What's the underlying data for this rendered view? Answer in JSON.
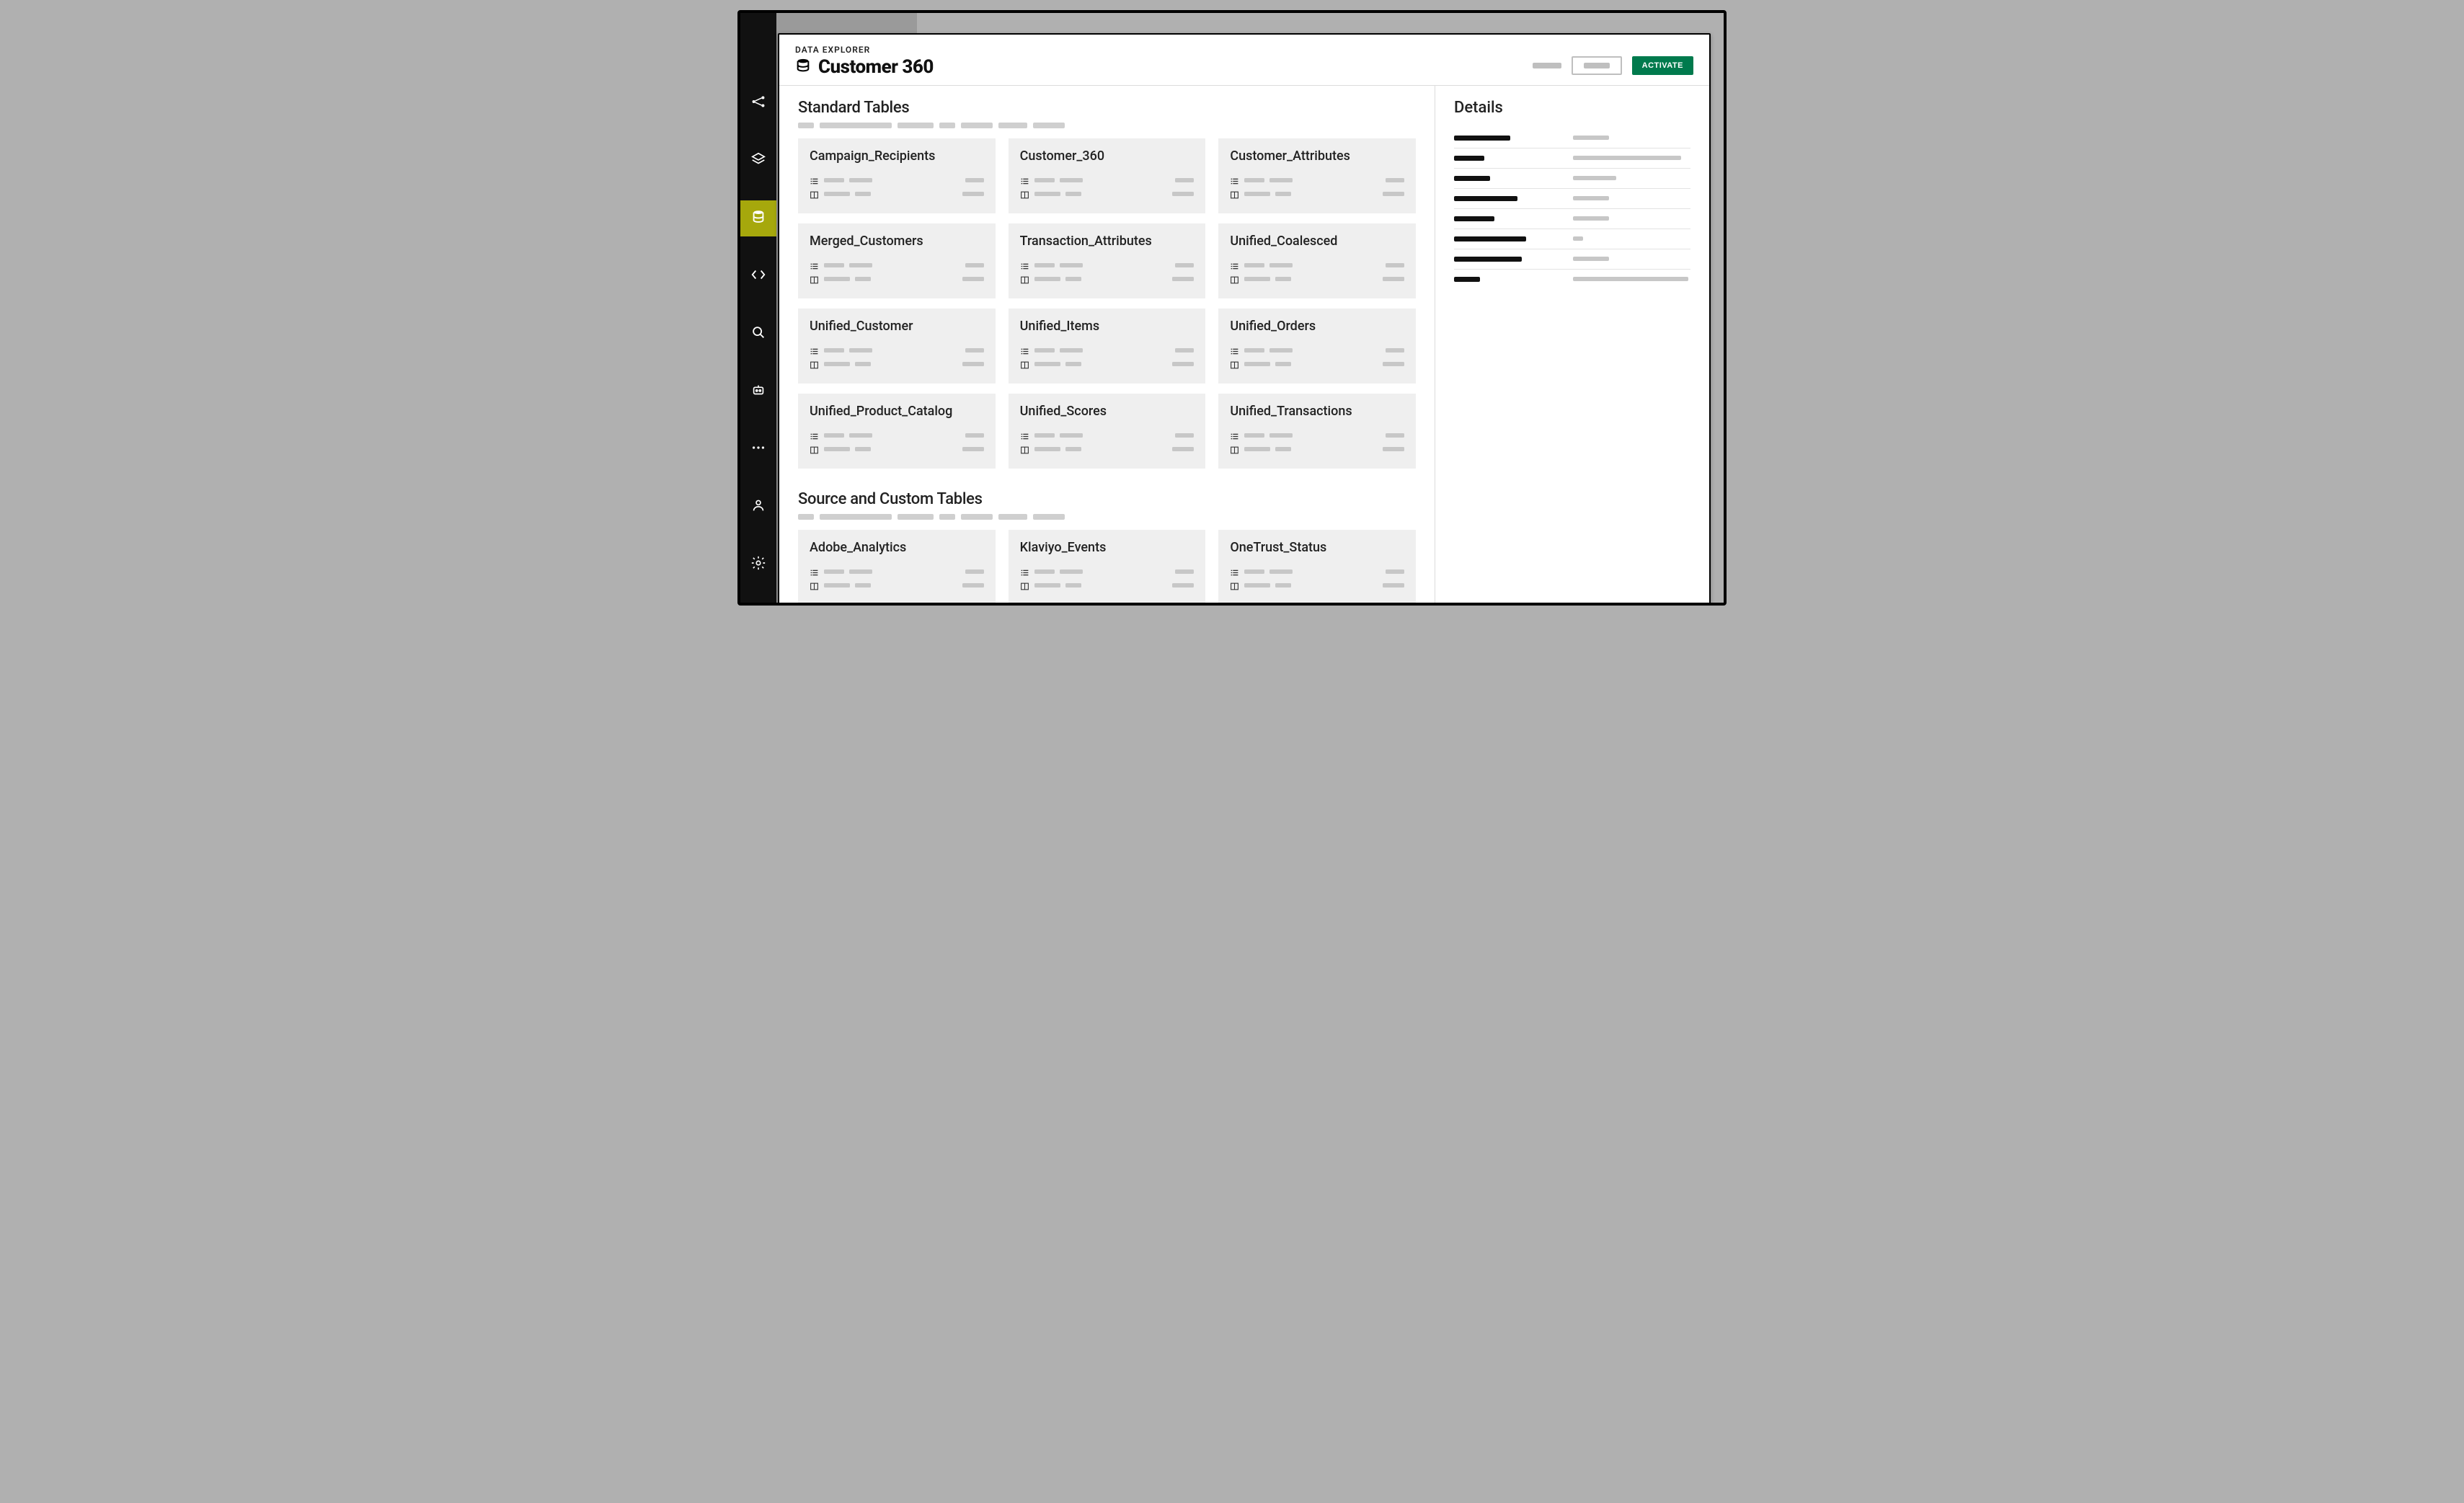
{
  "header": {
    "eyebrow": "DATA EXPLORER",
    "title": "Customer 360",
    "activate_label": "ACTIVATE"
  },
  "sections": [
    {
      "title": "Standard Tables",
      "sub_skel": [
        22,
        100,
        50,
        22,
        44,
        40,
        44
      ],
      "cards": [
        "Campaign_Recipients",
        "Customer_360",
        "Customer_Attributes",
        "Merged_Customers",
        "Transaction_Attributes",
        "Unified_Coalesced",
        "Unified_Customer",
        "Unified_Items",
        "Unified_Orders",
        "Unified_Product_Catalog",
        "Unified_Scores",
        "Unified_Transactions"
      ]
    },
    {
      "title": "Source and Custom Tables",
      "sub_skel": [
        22,
        100,
        50,
        22,
        44,
        40,
        44
      ],
      "cards": [
        "Adobe_Analytics",
        "Klaviyo_Events",
        "OneTrust_Status"
      ]
    }
  ],
  "details": {
    "title": "Details",
    "rows": [
      {
        "k": 78,
        "v": 50
      },
      {
        "k": 42,
        "v": 150
      },
      {
        "k": 50,
        "v": 60
      },
      {
        "k": 88,
        "v": 50
      },
      {
        "k": 56,
        "v": 50
      },
      {
        "k": 100,
        "v": 14
      },
      {
        "k": 94,
        "v": 50
      },
      {
        "k": 36,
        "v": 160
      }
    ]
  },
  "sidebar_items": [
    {
      "name": "connections-icon",
      "active": false
    },
    {
      "name": "schema-icon",
      "active": false
    },
    {
      "name": "database-icon",
      "active": true
    },
    {
      "name": "code-icon",
      "active": false
    },
    {
      "name": "search-icon",
      "active": false
    },
    {
      "name": "bot-icon",
      "active": false
    },
    {
      "name": "menu-dots-icon",
      "active": false
    },
    {
      "name": "audience-icon",
      "active": false
    },
    {
      "name": "settings-icon",
      "active": false
    }
  ],
  "card_meta_skel": {
    "row1_left": [
      28,
      32
    ],
    "row1_right": 26,
    "row2_left": [
      36,
      22
    ],
    "row2_right": 30
  }
}
